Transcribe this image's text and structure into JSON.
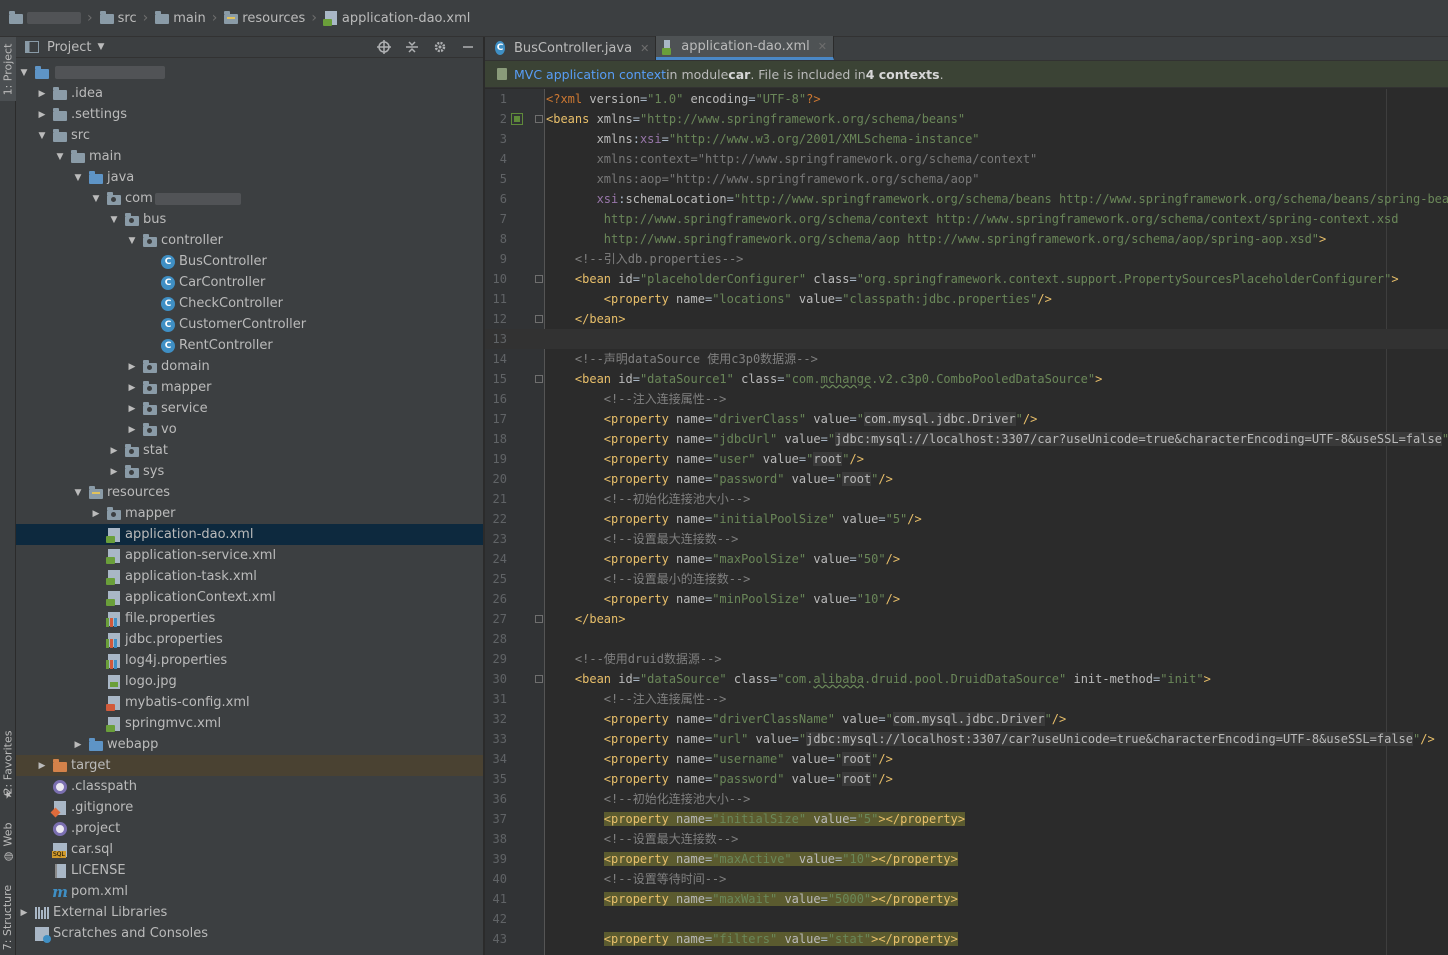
{
  "breadcrumb": [
    {
      "label": "src"
    },
    {
      "label": "main"
    },
    {
      "label": "resources"
    },
    {
      "label": "application-dao.xml"
    }
  ],
  "toolstrip": {
    "project_tab": "1: Project",
    "favorites_tab": "2: Favorites",
    "web_tab": "Web",
    "structure_tab": "7: Structure"
  },
  "project_panel": {
    "title": "Project"
  },
  "tree": [
    {
      "indent": 0,
      "arrow": "down",
      "icon": "folder-blue",
      "label": ""
    },
    {
      "indent": 1,
      "arrow": "right",
      "icon": "folder",
      "label": ".idea"
    },
    {
      "indent": 1,
      "arrow": "right",
      "icon": "folder",
      "label": ".settings"
    },
    {
      "indent": 1,
      "arrow": "down",
      "icon": "folder",
      "label": "src"
    },
    {
      "indent": 2,
      "arrow": "down",
      "icon": "folder",
      "label": "main"
    },
    {
      "indent": 3,
      "arrow": "down",
      "icon": "folder-blue",
      "label": "java"
    },
    {
      "indent": 4,
      "arrow": "down",
      "icon": "folder-pkg",
      "label": "com"
    },
    {
      "indent": 5,
      "arrow": "down",
      "icon": "folder-pkg",
      "label": "bus"
    },
    {
      "indent": 6,
      "arrow": "down",
      "icon": "folder-pkg",
      "label": "controller"
    },
    {
      "indent": 7,
      "arrow": "none",
      "icon": "class",
      "label": "BusController"
    },
    {
      "indent": 7,
      "arrow": "none",
      "icon": "class",
      "label": "CarController"
    },
    {
      "indent": 7,
      "arrow": "none",
      "icon": "class",
      "label": "CheckController"
    },
    {
      "indent": 7,
      "arrow": "none",
      "icon": "class",
      "label": "CustomerController"
    },
    {
      "indent": 7,
      "arrow": "none",
      "icon": "class",
      "label": "RentController"
    },
    {
      "indent": 6,
      "arrow": "right",
      "icon": "folder-pkg",
      "label": "domain"
    },
    {
      "indent": 6,
      "arrow": "right",
      "icon": "folder-pkg",
      "label": "mapper"
    },
    {
      "indent": 6,
      "arrow": "right",
      "icon": "folder-pkg",
      "label": "service"
    },
    {
      "indent": 6,
      "arrow": "right",
      "icon": "folder-pkg",
      "label": "vo"
    },
    {
      "indent": 5,
      "arrow": "right",
      "icon": "folder-pkg",
      "label": "stat"
    },
    {
      "indent": 5,
      "arrow": "right",
      "icon": "folder-pkg",
      "label": "sys"
    },
    {
      "indent": 3,
      "arrow": "down",
      "icon": "folder-res",
      "label": "resources"
    },
    {
      "indent": 4,
      "arrow": "right",
      "icon": "folder-pkg",
      "label": "mapper"
    },
    {
      "indent": 4,
      "arrow": "none",
      "icon": "xml-spring",
      "label": "application-dao.xml",
      "selected": true
    },
    {
      "indent": 4,
      "arrow": "none",
      "icon": "xml-spring",
      "label": "application-service.xml"
    },
    {
      "indent": 4,
      "arrow": "none",
      "icon": "xml-spring",
      "label": "application-task.xml"
    },
    {
      "indent": 4,
      "arrow": "none",
      "icon": "xml-spring",
      "label": "applicationContext.xml"
    },
    {
      "indent": 4,
      "arrow": "none",
      "icon": "properties",
      "label": "file.properties"
    },
    {
      "indent": 4,
      "arrow": "none",
      "icon": "properties",
      "label": "jdbc.properties"
    },
    {
      "indent": 4,
      "arrow": "none",
      "icon": "properties",
      "label": "log4j.properties"
    },
    {
      "indent": 4,
      "arrow": "none",
      "icon": "image",
      "label": "logo.jpg"
    },
    {
      "indent": 4,
      "arrow": "none",
      "icon": "xml",
      "label": "mybatis-config.xml"
    },
    {
      "indent": 4,
      "arrow": "none",
      "icon": "xml-spring",
      "label": "springmvc.xml"
    },
    {
      "indent": 3,
      "arrow": "right",
      "icon": "folder-blue",
      "label": "webapp"
    },
    {
      "indent": 1,
      "arrow": "right",
      "icon": "folder-orange",
      "label": "target",
      "target": true
    },
    {
      "indent": 1,
      "arrow": "none",
      "icon": "dotfile",
      "label": ".classpath"
    },
    {
      "indent": 1,
      "arrow": "none",
      "icon": "git",
      "label": ".gitignore"
    },
    {
      "indent": 1,
      "arrow": "none",
      "icon": "dotfile",
      "label": ".project"
    },
    {
      "indent": 1,
      "arrow": "none",
      "icon": "sql",
      "label": "car.sql"
    },
    {
      "indent": 1,
      "arrow": "none",
      "icon": "license",
      "label": "LICENSE"
    },
    {
      "indent": 1,
      "arrow": "none",
      "icon": "maven",
      "label": "pom.xml"
    },
    {
      "indent": 0,
      "arrow": "right",
      "icon": "library",
      "label": "External Libraries"
    },
    {
      "indent": 0,
      "arrow": "none",
      "icon": "scratch",
      "label": "Scratches and Consoles"
    }
  ],
  "tabs": [
    {
      "label": "BusController.java",
      "icon": "class",
      "active": false
    },
    {
      "label": "application-dao.xml",
      "icon": "xml-spring",
      "active": true
    }
  ],
  "banner": {
    "link": "MVC application context",
    "text1": " in module ",
    "module": "car",
    "text2": ". File is included in ",
    "count": "4 contexts",
    "text3": "."
  },
  "code_lines": [
    {
      "n": "1",
      "h": "<span class='p'>&lt;?xml </span><span class='a'>version</span>=<span class='v'>\"1.0\"</span> <span class='a'>encoding</span>=<span class='v'>\"UTF-8\"</span><span class='p'>?&gt;</span>"
    },
    {
      "n": "2",
      "h": "<span class='t'>&lt;beans </span><span class='a'>xmlns</span>=<span class='v'>\"http://www.springframework.org/schema/beans\"</span>",
      "gicon": true,
      "fold": true
    },
    {
      "n": "3",
      "h": "       <span class='a'>xmlns</span>:<span class='ns'>xsi</span>=<span class='v'>\"http://www.w3.org/2001/XMLSchema-instance\"</span>"
    },
    {
      "n": "4",
      "h": "       <span class='dim'>xmlns:context=\"http://www.springframework.org/schema/context\"</span>"
    },
    {
      "n": "5",
      "h": "       <span class='dim'>xmlns:aop=\"http://www.springframework.org/schema/aop\"</span>"
    },
    {
      "n": "6",
      "h": "       <span class='ns'>xsi</span>:<span class='a'>schemaLocation</span>=<span class='v'>\"http://www.springframework.org/schema/beans http://www.springframework.org/schema/beans/spring-beans.xsd</span>"
    },
    {
      "n": "7",
      "h": "        <span class='v'>http://www.springframework.org/schema/context http://www.springframework.org/schema/context/spring-context.xsd</span>"
    },
    {
      "n": "8",
      "h": "        <span class='v'>http://www.springframework.org/schema/aop http://www.springframework.org/schema/aop/spring-aop.xsd\"</span><span class='t'>&gt;</span>"
    },
    {
      "n": "9",
      "h": "    <span class='c'>&lt;!--引入db.properties--&gt;</span>"
    },
    {
      "n": "10",
      "h": "    <span class='t'>&lt;bean </span><span class='a'>id</span>=<span class='v'>\"placeholderConfigurer\"</span> <span class='a'>class</span>=<span class='v'>\"org.springframework.context.support.PropertySourcesPlaceholderConfigurer\"</span><span class='t'>&gt;</span>",
      "fold": true
    },
    {
      "n": "11",
      "h": "        <span class='t'>&lt;property </span><span class='a'>name</span>=<span class='v'>\"locations\"</span> <span class='a'>value</span>=<span class='v'>\"classpath:jdbc.properties\"</span><span class='t'>/&gt;</span>"
    },
    {
      "n": "12",
      "h": "    <span class='t'>&lt;/bean&gt;</span>",
      "fold": true
    },
    {
      "n": "13",
      "h": "",
      "cur": true
    },
    {
      "n": "14",
      "h": "    <span class='c'>&lt;!--声明dataSource 使用c3p0数据源--&gt;</span>"
    },
    {
      "n": "15",
      "h": "    <span class='t'>&lt;bean </span><span class='a'>id</span>=<span class='v'>\"dataSource1\"</span> <span class='a'>class</span>=<span class='v'>\"com.<span class='squig'>mchange</span>.v2.c3p0.ComboPooledDataSource\"</span><span class='t'>&gt;</span>",
      "fold": true
    },
    {
      "n": "16",
      "h": "        <span class='c'>&lt;!--注入连接属性--&gt;</span>"
    },
    {
      "n": "17",
      "h": "        <span class='t'>&lt;property </span><span class='a'>name</span>=<span class='v'>\"driverClass\"</span> <span class='a'>value</span>=<span class='v'>\"</span><span class='vu'>com.mysql.jdbc.Driver</span><span class='v'>\"</span><span class='t'>/&gt;</span>"
    },
    {
      "n": "18",
      "h": "        <span class='t'>&lt;property </span><span class='a'>name</span>=<span class='v'>\"jdbcUrl\"</span> <span class='a'>value</span>=<span class='v'>\"</span><span class='vu'>jdbc:mysql://localhost:3307/car?useUnicode=true&amp;characterEncoding=UTF-8&amp;useSSL=false</span><span class='v'>\"</span><span class='t'>/&gt;</span>"
    },
    {
      "n": "19",
      "h": "        <span class='t'>&lt;property </span><span class='a'>name</span>=<span class='v'>\"user\"</span> <span class='a'>value</span>=<span class='v'>\"</span><span class='vu'>root</span><span class='v'>\"</span><span class='t'>/&gt;</span>"
    },
    {
      "n": "20",
      "h": "        <span class='t'>&lt;property </span><span class='a'>name</span>=<span class='v'>\"password\"</span> <span class='a'>value</span>=<span class='v'>\"</span><span class='vu'>root</span><span class='v'>\"</span><span class='t'>/&gt;</span>"
    },
    {
      "n": "21",
      "h": "        <span class='c'>&lt;!--初始化连接池大小--&gt;</span>"
    },
    {
      "n": "22",
      "h": "        <span class='t'>&lt;property </span><span class='a'>name</span>=<span class='v'>\"initialPoolSize\"</span> <span class='a'>value</span>=<span class='v'>\"5\"</span><span class='t'>/&gt;</span>"
    },
    {
      "n": "23",
      "h": "        <span class='c'>&lt;!--设置最大连接数--&gt;</span>"
    },
    {
      "n": "24",
      "h": "        <span class='t'>&lt;property </span><span class='a'>name</span>=<span class='v'>\"maxPoolSize\"</span> <span class='a'>value</span>=<span class='v'>\"50\"</span><span class='t'>/&gt;</span>"
    },
    {
      "n": "25",
      "h": "        <span class='c'>&lt;!--设置最小的连接数--&gt;</span>"
    },
    {
      "n": "26",
      "h": "        <span class='t'>&lt;property </span><span class='a'>name</span>=<span class='v'>\"minPoolSize\"</span> <span class='a'>value</span>=<span class='v'>\"10\"</span><span class='t'>/&gt;</span>"
    },
    {
      "n": "27",
      "h": "    <span class='t'>&lt;/bean&gt;</span>",
      "fold": true
    },
    {
      "n": "28",
      "h": ""
    },
    {
      "n": "29",
      "h": "    <span class='c'>&lt;!--使用druid数据源--&gt;</span>"
    },
    {
      "n": "30",
      "h": "    <span class='t'>&lt;bean </span><span class='a'>id</span>=<span class='v'>\"dataSource\"</span> <span class='a'>class</span>=<span class='v'>\"com.<span class='squig'>alibaba</span>.druid.pool.DruidDataSource\"</span> <span class='a'>init-method</span>=<span class='v'>\"init\"</span><span class='t'>&gt;</span>",
      "fold": true
    },
    {
      "n": "31",
      "h": "        <span class='c'>&lt;!--注入连接属性--&gt;</span>"
    },
    {
      "n": "32",
      "h": "        <span class='t'>&lt;property </span><span class='a'>name</span>=<span class='v'>\"driverClassName\"</span> <span class='a'>value</span>=<span class='v'>\"</span><span class='vu'>com.mysql.jdbc.Driver</span><span class='v'>\"</span><span class='t'>/&gt;</span>"
    },
    {
      "n": "33",
      "h": "        <span class='t'>&lt;property </span><span class='a'>name</span>=<span class='v'>\"url\"</span> <span class='a'>value</span>=<span class='v'>\"</span><span class='vu'>jdbc:mysql://localhost:3307/car?useUnicode=true&amp;characterEncoding=UTF-8&amp;useSSL=false</span><span class='v'>\"</span><span class='t'>/&gt;</span>"
    },
    {
      "n": "34",
      "h": "        <span class='t'>&lt;property </span><span class='a'>name</span>=<span class='v'>\"username\"</span> <span class='a'>value</span>=<span class='v'>\"</span><span class='vu'>root</span><span class='v'>\"</span><span class='t'>/&gt;</span>"
    },
    {
      "n": "35",
      "h": "        <span class='t'>&lt;property </span><span class='a'>name</span>=<span class='v'>\"password\"</span> <span class='a'>value</span>=<span class='v'>\"</span><span class='vu'>root</span><span class='v'>\"</span><span class='t'>/&gt;</span>"
    },
    {
      "n": "36",
      "h": "        <span class='c'>&lt;!--初始化连接池大小--&gt;</span>"
    },
    {
      "n": "37",
      "h": "        <span class='hls'><span class='t'>&lt;property </span><span class='a'>name</span>=<span class='v'>\"initialSize\"</span> <span class='a'>value</span>=<span class='v'>\"5\"</span><span class='t'>&gt;&lt;/property&gt;</span></span>"
    },
    {
      "n": "38",
      "h": "        <span class='c'>&lt;!--设置最大连接数--&gt;</span>"
    },
    {
      "n": "39",
      "h": "        <span class='hls'><span class='t'>&lt;property </span><span class='a'>name</span>=<span class='v'>\"maxActive\"</span> <span class='a'>value</span>=<span class='v'>\"10\"</span><span class='t'>&gt;&lt;/property&gt;</span></span>"
    },
    {
      "n": "40",
      "h": "        <span class='c'>&lt;!--设置等待时间--&gt;</span>"
    },
    {
      "n": "41",
      "h": "        <span class='hls'><span class='t'>&lt;property </span><span class='a'>name</span>=<span class='v'>\"maxWait\"</span> <span class='a'>value</span>=<span class='v'>\"5000\"</span><span class='t'>&gt;&lt;/property&gt;</span></span>"
    },
    {
      "n": "42",
      "h": ""
    },
    {
      "n": "43",
      "h": "        <span class='hls'><span class='t'>&lt;property </span><span class='a'>name</span>=<span class='v'>\"filters\"</span> <span class='a'>value</span>=<span class='v'>\"stat\"</span><span class='t'>&gt;&lt;/property&gt;</span></span>"
    }
  ]
}
